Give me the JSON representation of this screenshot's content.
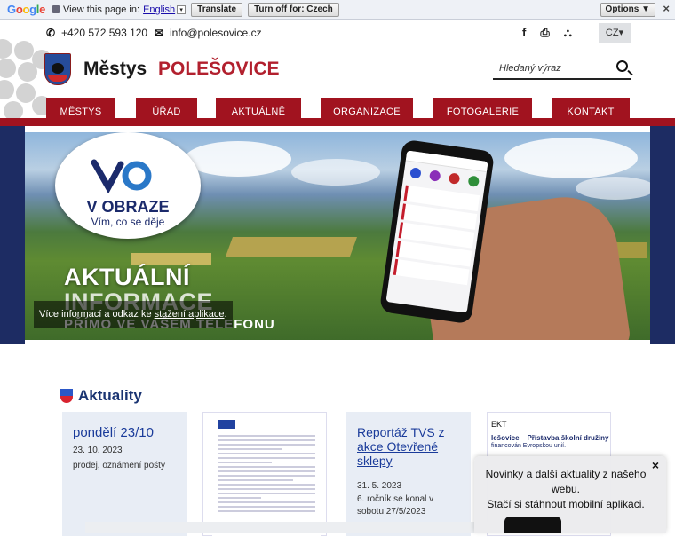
{
  "translate_bar": {
    "logo": "Google",
    "view_text": "View this page in:",
    "language": "English",
    "translate_label": "Translate",
    "turn_off_label": "Turn off for: Czech",
    "options_label": "Options ▼",
    "close": "×"
  },
  "contact": {
    "phone": "+420 572 593 120",
    "email": "info@polesovice.cz",
    "language": "CZ▾"
  },
  "header": {
    "brand_part1": "Městys",
    "brand_part2": "POLEŠOVICE",
    "search_placeholder": "Hledaný výraz"
  },
  "nav": {
    "items": [
      "MĚSTYS",
      "ÚŘAD",
      "AKTUÁLNĚ",
      "ORGANIZACE",
      "FOTOGALERIE",
      "KONTAKT"
    ]
  },
  "hero": {
    "logo_title": "V OBRAZE",
    "logo_subtitle": "Vím, co se děje",
    "line1": "AKTUÁLNÍ",
    "line2": "INFORMACE",
    "line3": "PŘÍMO VE VAŠEM TELEFONU",
    "caption_text": "Více informací a odkaz ke ",
    "caption_link": "stažení aplikace",
    "caption_end": "."
  },
  "news": {
    "heading": "Aktuality",
    "cards": [
      {
        "title": "pondělí 23/10",
        "date": "23. 10. 2023",
        "text": "prodej, oznámení pošty"
      },
      {
        "title": "",
        "date": "",
        "text": ""
      },
      {
        "title": "Reportáž TVS z akce Otevřené sklepy",
        "date": "31. 5. 2023",
        "text": "6. ročník se konal v sobotu 27/5/2023"
      },
      {
        "label": "EKT",
        "heading": "lešovice – Přístavba školní družiny",
        "sub": "financován Evropskou unií."
      }
    ]
  },
  "popup": {
    "line1": "Novinky a další aktuality z našeho webu.",
    "line2": "Stačí si stáhnout mobilní aplikaci.",
    "close": "×"
  },
  "colors": {
    "brand_red": "#a1131f",
    "brand_blue": "#1a3472"
  }
}
